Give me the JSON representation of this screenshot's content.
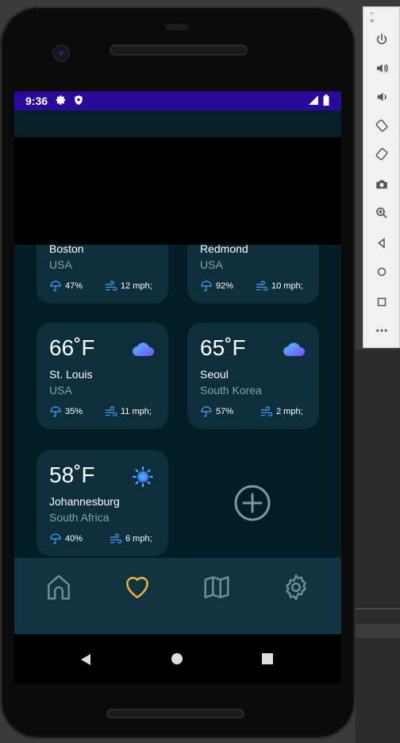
{
  "status_bar": {
    "time": "9:36",
    "bg_color": "#2a0a9a"
  },
  "colors": {
    "accent": "#f0b23f",
    "card_bg": "#0e2e3c",
    "content_bg": "#031d26",
    "nav_bg": "#113342",
    "stat_icon": "#4aa3ff"
  },
  "cities": [
    {
      "temp": "",
      "city": "Boston",
      "country": "USA",
      "humidity": "47%",
      "wind": "12 mph;",
      "icon": "partly-cloudy-icon"
    },
    {
      "temp": "",
      "city": "Redmond",
      "country": "USA",
      "humidity": "92%",
      "wind": "10 mph;",
      "icon": "partly-cloudy-icon"
    },
    {
      "temp": "66˚F",
      "city": "St. Louis",
      "country": "USA",
      "humidity": "35%",
      "wind": "11 mph;",
      "icon": "cloudy-icon"
    },
    {
      "temp": "65˚F",
      "city": "Seoul",
      "country": "South Korea",
      "humidity": "57%",
      "wind": "2 mph;",
      "icon": "cloudy-icon"
    },
    {
      "temp": "58˚F",
      "city": "Johannesburg",
      "country": "South Africa",
      "humidity": "40%",
      "wind": "6 mph;",
      "icon": "sunny-icon"
    }
  ],
  "bottom_nav": {
    "items": [
      "home-icon",
      "heart-icon",
      "map-icon",
      "gear-icon"
    ],
    "active": "heart-icon"
  },
  "emulator_toolbar": {
    "window_controls": "– ×",
    "buttons": [
      "power-icon",
      "volume-up-icon",
      "volume-down-icon",
      "rotate-left-icon",
      "rotate-right-icon",
      "camera-icon",
      "zoom-icon",
      "back-icon",
      "home-icon",
      "overview-icon",
      "more-icon"
    ]
  }
}
